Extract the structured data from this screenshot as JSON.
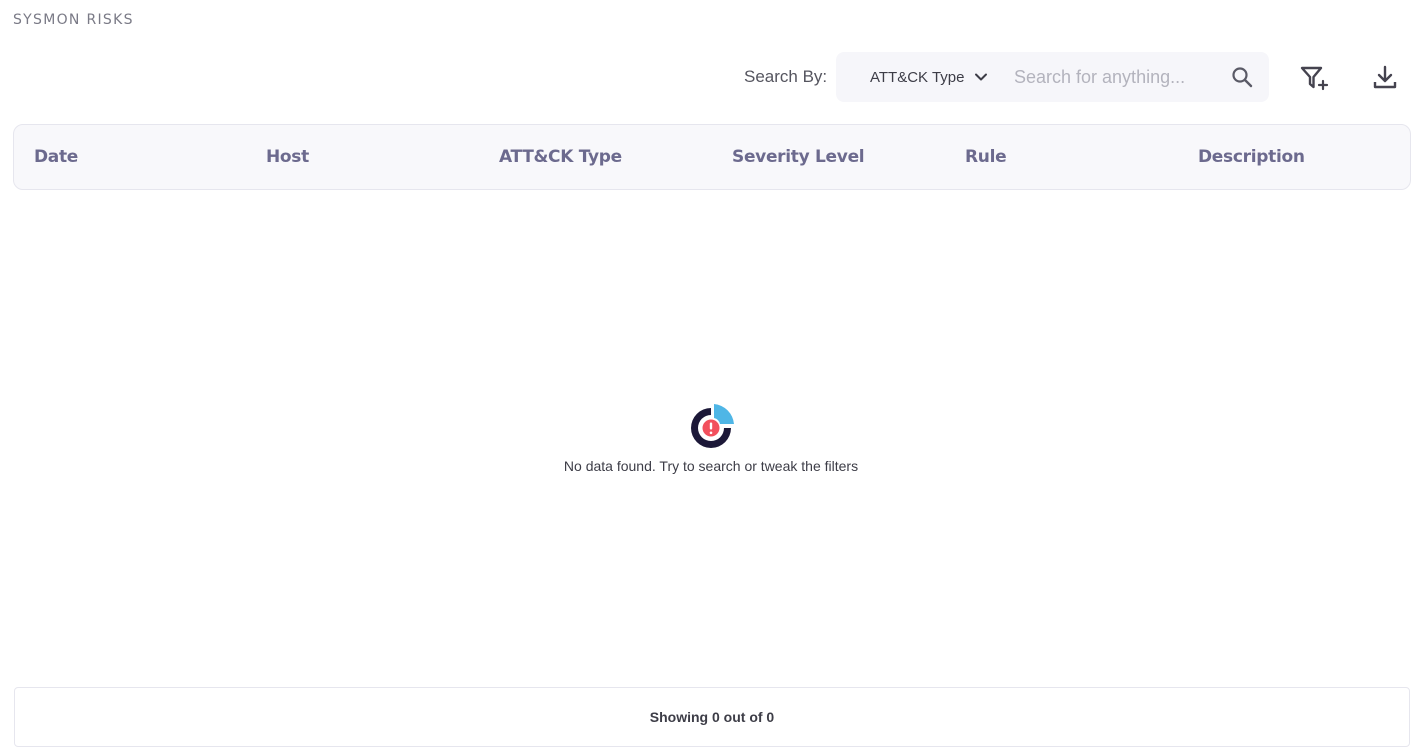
{
  "page": {
    "title": "SYSMON RISKS"
  },
  "toolbar": {
    "search_by_label": "Search By:",
    "search_by_selected": "ATT&CK Type",
    "search_placeholder": "Search for anything...",
    "search_value": "",
    "icons": {
      "chevron": "chevron-down-icon",
      "search": "search-icon",
      "add_filter": "filter-add-icon",
      "download": "download-icon"
    }
  },
  "table": {
    "columns": [
      "Date",
      "Host",
      "ATT&CK Type",
      "Severity Level",
      "Rule",
      "Description"
    ],
    "rows": []
  },
  "empty_state": {
    "icon": "no-data-icon",
    "message": "No data found. Try to search or tweak the filters"
  },
  "footer": {
    "showing_text": "Showing 0 out of 0"
  },
  "colors": {
    "header_text": "#6c6a8e",
    "icon_dark": "#1c1838",
    "icon_accent_blue": "#4fb6e6",
    "icon_alert_red": "#f2505d"
  }
}
